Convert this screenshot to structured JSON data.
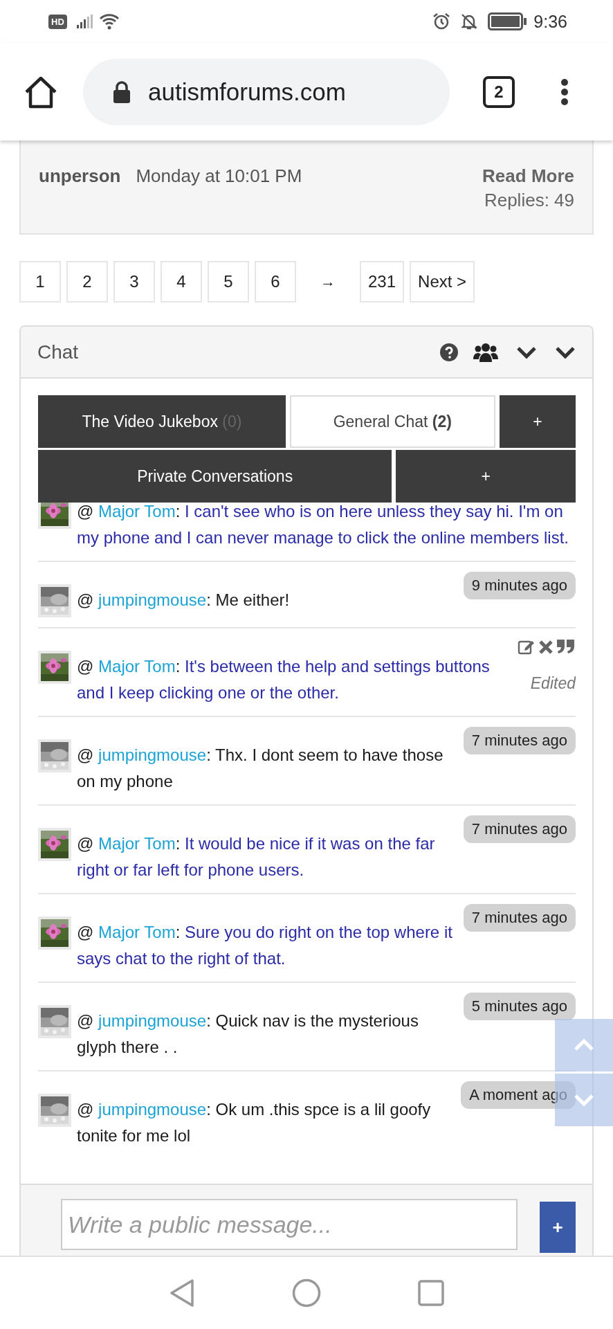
{
  "status_bar": {
    "badge": "HD",
    "time": "9:36"
  },
  "browser": {
    "url": "autismforums.com",
    "tab_count": "2"
  },
  "thread": {
    "author": "unperson",
    "date": "Monday at 10:01 PM",
    "read_more": "Read More",
    "replies": "Replies: 49"
  },
  "pagination": [
    {
      "label": "1",
      "kind": "page"
    },
    {
      "label": "2",
      "kind": "page"
    },
    {
      "label": "3",
      "kind": "page"
    },
    {
      "label": "4",
      "kind": "page"
    },
    {
      "label": "5",
      "kind": "page"
    },
    {
      "label": "6",
      "kind": "page"
    },
    {
      "label": "→",
      "kind": "gap"
    },
    {
      "label": "231",
      "kind": "page"
    },
    {
      "label": "Next >",
      "kind": "page"
    }
  ],
  "chat": {
    "title": "Chat",
    "tab_rows": [
      [
        {
          "label": "The Video Jukebox",
          "count": "(0)",
          "selected": false
        },
        {
          "label": "General Chat",
          "count": "(2)",
          "selected": true
        },
        {
          "label": "+",
          "selected": false
        }
      ],
      [
        {
          "label": "Private Conversations",
          "selected": false
        },
        {
          "label": "+",
          "selected": false
        }
      ]
    ],
    "messages": [
      {
        "kind": "timestamped",
        "at": "@",
        "user": "Major Tom",
        "separator": ":",
        "text": "I can't see who is on here unless they say hi. I'm on my phone and I can never manage to click the online members list.",
        "color": "#2b2ba8"
      },
      {
        "kind": "timestamped",
        "at": "@",
        "user": "jumpingmouse",
        "separator": ":",
        "text": "Me either!",
        "color": "#1a1a1a",
        "time": "9 minutes ago"
      },
      {
        "kind": "editable",
        "at": "@",
        "user": "Major Tom",
        "separator": ":",
        "text": "It's between the help and settings buttons and I keep clicking one or the other.",
        "color": "#2b2ba8",
        "status": "Edited"
      },
      {
        "kind": "timestamped",
        "at": "@",
        "user": "jumpingmouse",
        "separator": ":",
        "text": "Thx. I dont seem to have those on my phone",
        "color": "#1a1a1a",
        "time": "7 minutes ago"
      },
      {
        "kind": "timestamped",
        "at": "@",
        "user": "Major Tom",
        "separator": ":",
        "text": "It would be nice if it was on the far right or far left for phone users.",
        "color": "#2b2ba8",
        "time": "7 minutes ago"
      },
      {
        "kind": "timestamped",
        "at": "@",
        "user": "Major Tom",
        "separator": ":",
        "text": "Sure you do right on the top where it says chat to the right of that.",
        "color": "#2b2ba8",
        "time": "7 minutes ago"
      },
      {
        "kind": "timestamped",
        "at": "@",
        "user": "jumpingmouse",
        "separator": ":",
        "text": "Quick nav is the mysterious glyph there . .",
        "color": "#1a1a1a",
        "time": "5 minutes ago"
      },
      {
        "kind": "timestamped",
        "at": "@",
        "user": "jumpingmouse",
        "separator": ":",
        "text": "Ok um .this spce is a lil goofy tonite for me lol",
        "color": "#1a1a1a",
        "time": "A moment ago"
      }
    ],
    "input": {
      "placeholder": "Write a public message...",
      "send": "+"
    }
  }
}
